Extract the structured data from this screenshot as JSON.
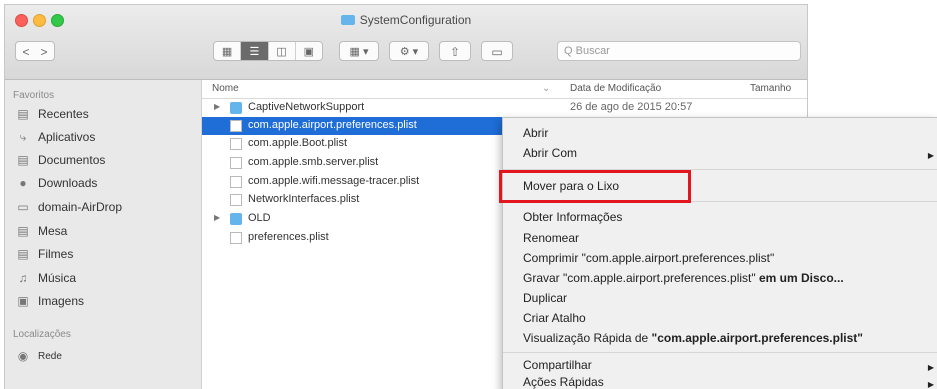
{
  "window": {
    "title": "SystemConfiguration"
  },
  "toolbar": {
    "back": "<",
    "forward": ">",
    "search_placeholder": "Q Buscar"
  },
  "sidebar": {
    "favorites_heading": "Favoritos",
    "items": [
      {
        "label": "Recentes",
        "icon": "recents-icon"
      },
      {
        "label": "Aplicativos",
        "icon": "apps-icon"
      },
      {
        "label": "Documentos",
        "icon": "documents-icon"
      },
      {
        "label": "Downloads",
        "icon": "downloads-icon"
      },
      {
        "label": "domain-AirDrop",
        "icon": "airdrop-icon"
      },
      {
        "label": "Mesa",
        "icon": "desktop-icon"
      },
      {
        "label": "Filmes",
        "icon": "movies-icon"
      },
      {
        "label": "Música",
        "icon": "music-icon"
      },
      {
        "label": "Imagens",
        "icon": "pictures-icon"
      }
    ],
    "locations_heading": "Localizações",
    "locations": [
      {
        "label": "Rede",
        "icon": "network-icon"
      }
    ]
  },
  "columns": {
    "name": "Nome",
    "modified": "Data de Modificação",
    "size": "Tamanho"
  },
  "files": [
    {
      "name": "CaptiveNetworkSupport",
      "date": "26 de ago de 2015 20:57"
    },
    {
      "name": "com.apple.airport.preferences.plist",
      "date": ""
    },
    {
      "name": "com.apple.Boot.plist",
      "date": ""
    },
    {
      "name": "com.apple.smb.server.plist",
      "date": ""
    },
    {
      "name": "com.apple.wifi.message-tracer.plist",
      "date": ""
    },
    {
      "name": "NetworkInterfaces.plist",
      "date": ""
    },
    {
      "name": "OLD",
      "date": ""
    },
    {
      "name": "preferences.plist",
      "date": ""
    }
  ],
  "menu": {
    "open": "Abrir",
    "open_with": "Abrir Com",
    "move_to_trash": "Mover para o Lixo",
    "get_info": "Obter Informações",
    "rename": "Renomear",
    "compress_prefix": "Comprimir \"com.apple.airport.preferences.plist\"",
    "burn_prefix": "Gravar \"com.apple.airport.preferences.plist\"",
    "burn_suffix": "em um Disco...",
    "duplicate": "Duplicar",
    "make_alias": "Criar Atalho",
    "quick_look_prefix": "Visualização Rápida de",
    "quick_look_name": "\"com.apple.airport.preferences.plist\"",
    "share": "Compartilhar",
    "quick_actions": "Ações Rápidas"
  },
  "highlight_color": "#e3161f",
  "selection_color": "#1f6dd7"
}
